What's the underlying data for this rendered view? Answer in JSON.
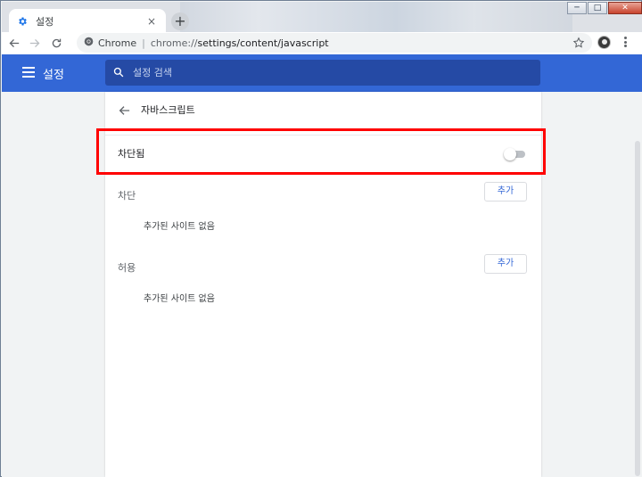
{
  "window": {
    "controls": {
      "minimize": "─",
      "maximize": "□",
      "close": "✕"
    }
  },
  "tab": {
    "label": "설정",
    "icon": "gear-icon",
    "close": "×",
    "new_tab": "+"
  },
  "toolbar": {
    "omnibox_site": "Chrome",
    "omnibox_separator": "|",
    "url_host": "chrome://",
    "url_path": "settings/content/javascript"
  },
  "header": {
    "title": "설정",
    "search_placeholder": "설정 검색"
  },
  "subpage": {
    "title": "자바스크립트",
    "toggle_label": "차단됨",
    "toggle_on": false
  },
  "sections": {
    "block": {
      "label": "차단",
      "add_label": "추가",
      "empty_text": "추가된 사이트 없음"
    },
    "allow": {
      "label": "허용",
      "add_label": "추가",
      "empty_text": "추가된 사이트 없음"
    }
  },
  "colors": {
    "accent": "#3367d6",
    "highlight": "#ff0000"
  }
}
